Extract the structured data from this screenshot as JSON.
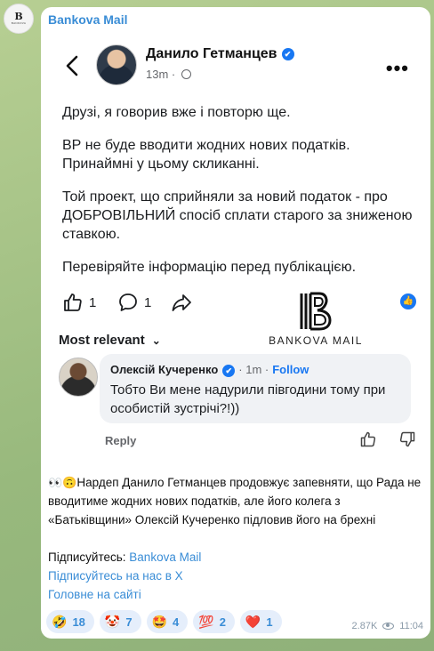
{
  "channel": {
    "name": "Bankova Mail",
    "avatar_mark": "B",
    "avatar_text": "BANKOVA"
  },
  "post": {
    "author": "Данило Гетманцев",
    "time": "13m",
    "paragraphs": [
      "Друзі, я говорив вже і повторю ще.",
      "ВР не буде вводити жодних нових податків. Принаймні у цьому скликанні.",
      "Той проект, що сприйняли за новий податок - про ДОБРОВІЛЬНИЙ спосіб сплати старого за зниженою ставкою.",
      "Перевіряйте інформацію перед публікацією."
    ],
    "likes": "1",
    "comments": "1",
    "sort_label": "Most relevant"
  },
  "watermark": {
    "text": "BANKOVA MAIL"
  },
  "comment": {
    "author": "Олексій Кучеренко",
    "time": "· 1m ·",
    "follow": "Follow",
    "text": "Тобто Ви мене надурили півгодини тому при особистій зустрічі?!))",
    "reply": "Reply"
  },
  "caption": {
    "emoji": "👀🙃",
    "text": "Нардеп Данило Гетманцев продовжує запевняти, що Рада не вводитиме жодних нових податків, але його колега з «Батьківщини» Олексій Кучеренко підловив його на брехні"
  },
  "links": {
    "subscribe_prefix": "Підписуйтесь: ",
    "subscribe_link": "Bankova Mail",
    "x_link": "Підписуйтесь на нас в Х",
    "site_link": "Головне на сайті"
  },
  "reactions": [
    {
      "emoji": "🤣",
      "count": "18"
    },
    {
      "emoji": "🤡",
      "count": "7"
    },
    {
      "emoji": "🤩",
      "count": "4"
    },
    {
      "emoji": "💯",
      "count": "2"
    },
    {
      "emoji": "❤️",
      "count": "1"
    }
  ],
  "footer": {
    "views": "2.87K",
    "time": "11:04"
  },
  "colors": {
    "accent": "#3a8dd6",
    "fb_blue": "#1877f2"
  }
}
